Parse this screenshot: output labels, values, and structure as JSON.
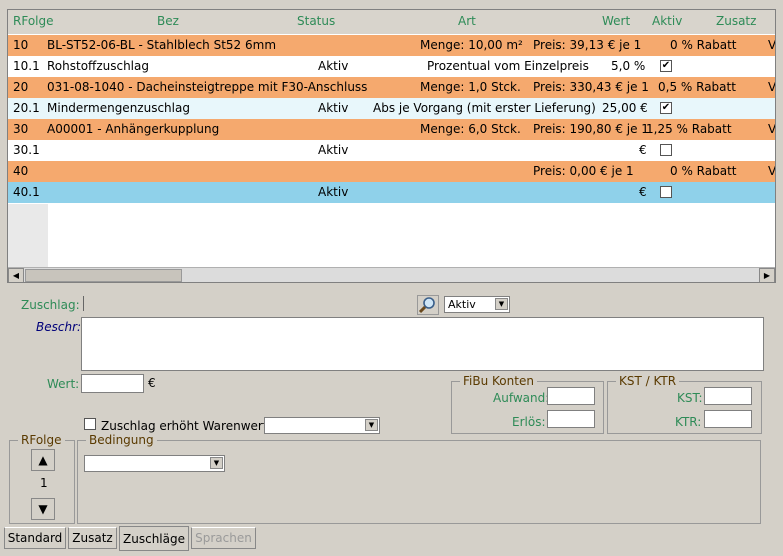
{
  "columns": {
    "rfolge": "RFolge",
    "bez": "Bez",
    "status": "Status",
    "art": "Art",
    "wert": "Wert",
    "aktiv": "Aktiv",
    "zusatz": "Zusatz"
  },
  "rows": [
    {
      "rfolge": "10",
      "bez": "BL-ST52-06-BL - Stahlblech St52 6mm",
      "menge": "Menge: 10,00 m²",
      "preis": "Preis: 39,13 € je 1",
      "zusatz": "0 % Rabatt",
      "v": "V",
      "style": "orange"
    },
    {
      "rfolge": "10.1",
      "bez": "Rohstoffzuschlag",
      "status": "Aktiv",
      "art": "Prozentual vom Einzelpreis",
      "wert": "5,0 %",
      "aktiv": true,
      "style": "white"
    },
    {
      "rfolge": "20",
      "bez": "031-08-1040 - Dacheinsteigtreppe mit F30-Anschluss",
      "menge": "Menge: 1,0 Stck.",
      "preis": "Preis: 330,43 € je 1",
      "zusatz": "0,5 % Rabatt",
      "v": "V",
      "style": "orange"
    },
    {
      "rfolge": "20.1",
      "bez": "Mindermengenzuschlag",
      "status": "Aktiv",
      "art": "Abs je Vorgang (mit erster Lieferung)",
      "wert": "25,00 €",
      "aktiv": true,
      "style": "light"
    },
    {
      "rfolge": "30",
      "bez": "A00001 - Anhängerkupplung",
      "menge": "Menge: 6,0 Stck.",
      "preis": "Preis: 190,80 € je 1",
      "zusatz": "1,25 % Rabatt",
      "v": "V",
      "style": "orange"
    },
    {
      "rfolge": "30.1",
      "bez": "",
      "status": "Aktiv",
      "art": "",
      "wert": "€",
      "aktiv": false,
      "style": "white"
    },
    {
      "rfolge": "40",
      "bez": "",
      "preis": "Preis: 0,00 € je 1",
      "zusatz": "0 % Rabatt",
      "v": "V",
      "style": "orange"
    },
    {
      "rfolge": "40.1",
      "bez": "",
      "status": "Aktiv",
      "art": "",
      "wert": "€",
      "aktiv": false,
      "style": "sel"
    }
  ],
  "form": {
    "zuschlag_label": "Zuschlag:",
    "beschr_label": "Beschr:",
    "status_value": "Aktiv",
    "wert_label": "Wert:",
    "wert_unit": "€",
    "checkbox_label": "Zuschlag erhöht Warenwert",
    "fibu_title": "FiBu Konten",
    "aufwand_label": "Aufwand:",
    "erloes_label": "Erlös:",
    "kst_title": "KST / KTR",
    "kst_label": "KST:",
    "ktr_label": "KTR:",
    "rfolge_title": "RFolge",
    "rfolge_value": "1",
    "bedingung_title": "Bedingung"
  },
  "tabs": [
    "Standard",
    "Zusatz",
    "Zuschläge",
    "Sprachen"
  ],
  "arrows": {
    "up": "▲",
    "down": "▼",
    "left": "◀",
    "right": "▶",
    "drop": "▼"
  }
}
